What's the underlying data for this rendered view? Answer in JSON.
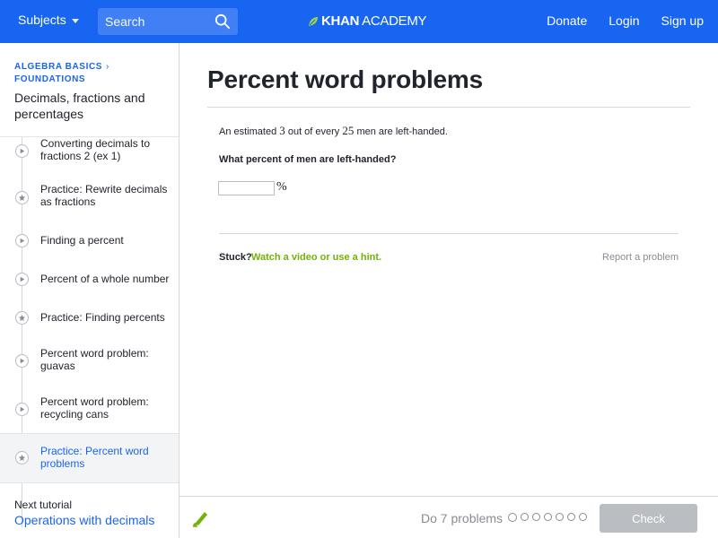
{
  "header": {
    "subjects_label": "Subjects",
    "search_placeholder": "Search",
    "logo_bold": "KHAN",
    "logo_light": "ACADEMY",
    "donate_label": "Donate",
    "login_label": "Login",
    "signup_label": "Sign up",
    "bar_color": "#1865f2"
  },
  "sidebar": {
    "breadcrumb_line1": "ALGEBRA BASICS",
    "breadcrumb_line2": "FOUNDATIONS",
    "unit_title": "Decimals, fractions and percentages",
    "items": [
      {
        "label": "Converting decimals to fractions 2 (ex 1)",
        "kind": "video"
      },
      {
        "label": "Practice: Rewrite decimals as fractions",
        "kind": "practice"
      },
      {
        "label": "Finding a percent",
        "kind": "video"
      },
      {
        "label": "Percent of a whole number",
        "kind": "video"
      },
      {
        "label": "Practice: Finding percents",
        "kind": "practice"
      },
      {
        "label": "Percent word problem: guavas",
        "kind": "video"
      },
      {
        "label": "Percent word problem: recycling cans",
        "kind": "video"
      },
      {
        "label": "Practice: Percent word problems",
        "kind": "practice",
        "active": true
      }
    ],
    "next_label": "Next tutorial",
    "next_link": "Operations with decimals"
  },
  "main": {
    "title": "Percent word problems",
    "problem_pre": "An estimated",
    "problem_num1": "3",
    "problem_mid": "out of every",
    "problem_num2": "25",
    "problem_post": "men are left-handed.",
    "question": "What percent of men are left-handed?",
    "answer_value": "",
    "percent_sign": "%",
    "stuck_label": "Stuck?",
    "hint_link": "Watch a video or use a hint.",
    "report_label": "Report a problem"
  },
  "footer": {
    "do_problems": "Do 7 problems",
    "problem_count": 7,
    "check_label": "Check",
    "accent_green": "#71b307"
  }
}
